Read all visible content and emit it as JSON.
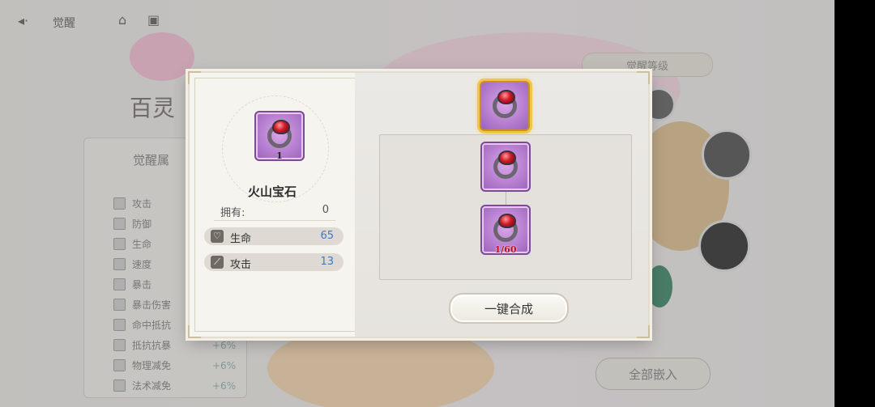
{
  "background": {
    "back_label": "觉醒",
    "page_title": "百灵",
    "panel_header": "觉醒属",
    "side_rows": [
      "攻击",
      "防御",
      "生命",
      "速度",
      "暴击",
      "暴击伤害",
      "命中抵抗",
      "抵抗抗暴",
      "物理减免",
      "法术减免"
    ],
    "side_percents": [
      "+6%",
      "+6%",
      "+6%",
      "+6%"
    ],
    "top_tag": "觉醒等级",
    "bottom_button": "全部嵌入"
  },
  "modal": {
    "item": {
      "name": "火山宝石",
      "icon": "red-gem-ring-icon",
      "level_badge": "1",
      "own_label": "拥有:",
      "own_value": "0",
      "stats": [
        {
          "icon": "heart-icon",
          "label": "生命",
          "value": "65"
        },
        {
          "icon": "sword-icon",
          "label": "攻击",
          "value": "13"
        }
      ]
    },
    "synthesis": {
      "target_icon": "red-gem-ring-icon",
      "chain": [
        {
          "icon": "red-gem-ring-icon",
          "badge": ""
        },
        {
          "icon": "red-gem-ring-icon",
          "badge": "1/60"
        }
      ]
    },
    "one_key_button": "一键合成"
  },
  "colors": {
    "stat_value": "#3a7ac8",
    "item_frame": "#b77fd0",
    "select_glow": "#f0c64a",
    "badge_red": "#c0111e"
  }
}
